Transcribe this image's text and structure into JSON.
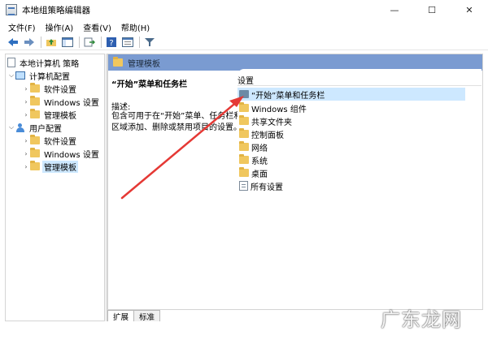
{
  "window": {
    "title": "本地组策略编辑器",
    "minimize": "—",
    "maximize": "☐",
    "close": "✕"
  },
  "menu": [
    "文件(F)",
    "操作(A)",
    "查看(V)",
    "帮助(H)"
  ],
  "tree": {
    "root": "本地计算机 策略",
    "computer_config": "计算机配置",
    "cc_software": "软件设置",
    "cc_windows": "Windows 设置",
    "cc_admin": "管理模板",
    "user_config": "用户配置",
    "uc_software": "软件设置",
    "uc_windows": "Windows 设置",
    "uc_admin": "管理模板"
  },
  "right": {
    "header": "管理模板",
    "desc_title": "“开始”菜单和任务栏",
    "desc_label": "描述:",
    "desc_text": "包含可用于在“开始”菜单、任务栏和通知区域添加、删除或禁用项目的设置。",
    "settings_header": "设置",
    "items": [
      "“开始”菜单和任务栏",
      "Windows 组件",
      "共享文件夹",
      "控制面板",
      "网络",
      "系统",
      "桌面",
      "所有设置"
    ]
  },
  "tabs": [
    "扩展",
    "标准"
  ],
  "watermark": "广东龙网",
  "colors": {
    "header_band": "#7a9bd1",
    "selection": "#cde8ff",
    "annotation_arrow": "#e53935",
    "folder": "#f0c75e"
  }
}
